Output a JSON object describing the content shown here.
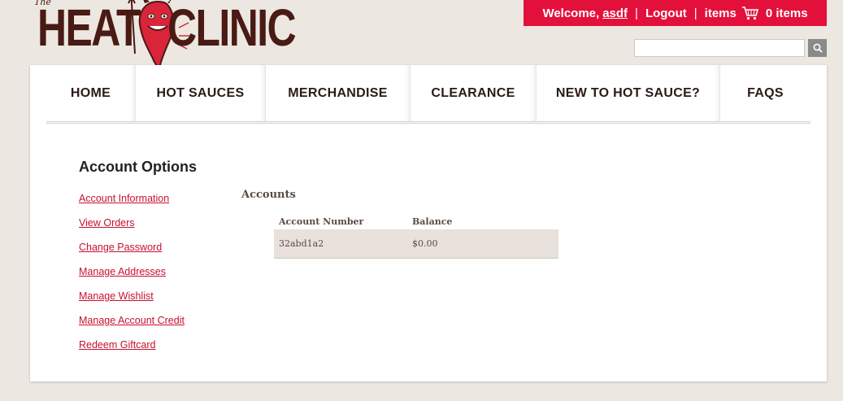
{
  "logo": {
    "the": "The",
    "heat": "HEAT",
    "clinic": "CLINIC"
  },
  "topbar": {
    "welcome": "Welcome,",
    "username": "asdf",
    "sep1": "|",
    "logout": "Logout",
    "sep2": "|",
    "items_label": "items",
    "cart_count": "0 items",
    "bg_color": "#e3103c"
  },
  "search": {
    "value": "",
    "placeholder": ""
  },
  "nav": {
    "items": [
      {
        "label": "HOME"
      },
      {
        "label": "HOT SAUCES"
      },
      {
        "label": "MERCHANDISE"
      },
      {
        "label": "CLEARANCE"
      },
      {
        "label": "NEW TO HOT SAUCE?"
      },
      {
        "label": "FAQS"
      }
    ]
  },
  "sidebar": {
    "title": "Account Options",
    "links": [
      {
        "label": "Account Information"
      },
      {
        "label": "View Orders"
      },
      {
        "label": "Change Password"
      },
      {
        "label": "Manage Addresses"
      },
      {
        "label": "Manage Wishlist"
      },
      {
        "label": "Manage Account Credit"
      },
      {
        "label": "Redeem Giftcard"
      }
    ]
  },
  "accounts": {
    "heading": "Accounts",
    "columns": [
      "Account Number",
      "Balance"
    ],
    "rows": [
      {
        "account_number": "32abd1a2",
        "balance": "$0.00"
      }
    ]
  },
  "colors": {
    "accent": "#e3103c",
    "link": "#c8102e",
    "logo": "#4a1a14"
  }
}
